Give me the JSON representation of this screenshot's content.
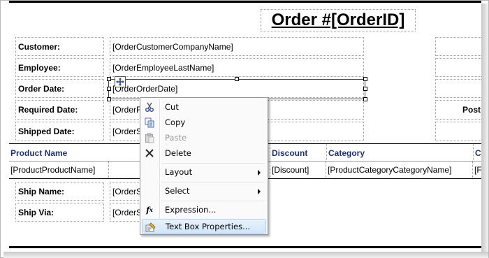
{
  "report": {
    "title": "Order #[OrderID]",
    "fields": [
      {
        "label": "Customer:",
        "value": "[OrderCustomerCompanyName]"
      },
      {
        "label": "Employee:",
        "value": "[OrderEmployeeLastName]"
      },
      {
        "label": "Order Date:",
        "value": "[OrderOrderDate]"
      },
      {
        "label": "Required Date:",
        "value": "[OrderF"
      },
      {
        "label": "Shipped Date:",
        "value": "[OrderS"
      }
    ],
    "right_label_partial": "Post",
    "table_headers": [
      "Product Name",
      "Discount",
      "Category",
      "C"
    ],
    "table_row": [
      "[ProductProductName]",
      "[Discount]",
      "[ProductCategoryCategoryName]",
      "[F"
    ],
    "ship_fields": [
      {
        "label": "Ship Name:",
        "value": "[OrderS"
      },
      {
        "label": "Ship Via:",
        "value": "[OrderS"
      }
    ]
  },
  "context_menu": {
    "items": [
      {
        "label": "Cut",
        "icon": "scissors-icon"
      },
      {
        "label": "Copy",
        "icon": "copy-icon"
      },
      {
        "label": "Paste",
        "icon": "paste-icon",
        "disabled": true
      },
      {
        "label": "Delete",
        "icon": "delete-x-icon"
      },
      {
        "label": "Layout",
        "submenu": true
      },
      {
        "label": "Select",
        "submenu": true
      },
      {
        "label": "Expression...",
        "icon": "function-fx-icon"
      },
      {
        "label": "Text Box Properties...",
        "icon": "properties-icon",
        "highlighted": true
      }
    ]
  },
  "colors": {
    "header_text": "#1f2f82",
    "menu_highlight": "#d0e6f9"
  }
}
